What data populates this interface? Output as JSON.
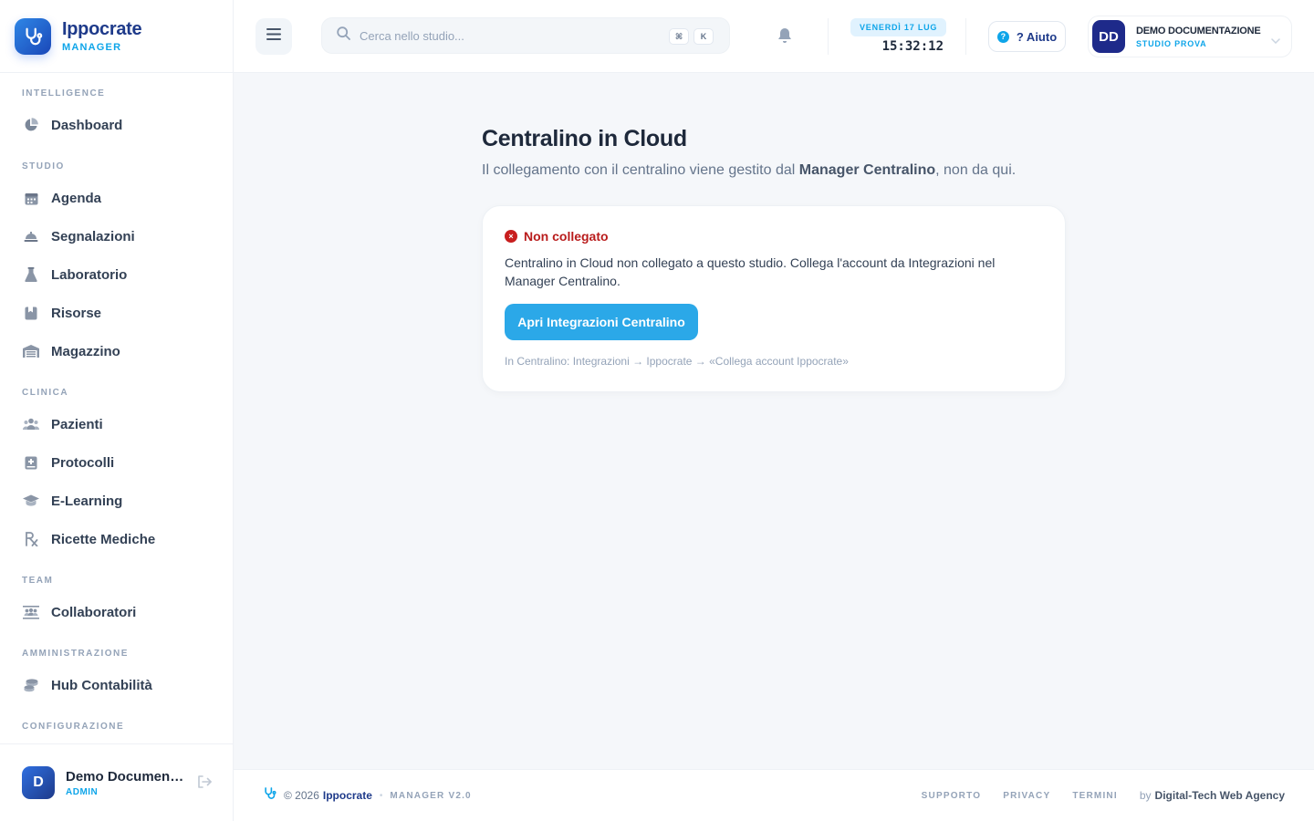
{
  "brand": {
    "name": "Ippocrate",
    "subtitle": "MANAGER"
  },
  "colors": {
    "brand_blue": "#1e3a8a",
    "accent": "#0ea5e9",
    "primary_button": "#2ba8e8",
    "error": "#b91c1c"
  },
  "sidebar": {
    "sections": [
      {
        "label": "INTELLIGENCE",
        "items": [
          {
            "label": "Dashboard",
            "icon": "pie-chart-icon"
          }
        ]
      },
      {
        "label": "STUDIO",
        "items": [
          {
            "label": "Agenda",
            "icon": "calendar-icon"
          },
          {
            "label": "Segnalazioni",
            "icon": "bell-service-icon"
          },
          {
            "label": "Laboratorio",
            "icon": "flask-icon"
          },
          {
            "label": "Risorse",
            "icon": "bookmark-icon"
          },
          {
            "label": "Magazzino",
            "icon": "warehouse-icon"
          }
        ]
      },
      {
        "label": "CLINICA",
        "items": [
          {
            "label": "Pazienti",
            "icon": "users-icon"
          },
          {
            "label": "Protocolli",
            "icon": "medical-book-icon"
          },
          {
            "label": "E-Learning",
            "icon": "graduation-cap-icon"
          },
          {
            "label": "Ricette Mediche",
            "icon": "prescription-icon"
          }
        ]
      },
      {
        "label": "TEAM",
        "items": [
          {
            "label": "Collaboratori",
            "icon": "team-icon"
          }
        ]
      },
      {
        "label": "AMMINISTRAZIONE",
        "items": [
          {
            "label": "Hub Contabilità",
            "icon": "coins-icon"
          }
        ]
      },
      {
        "label": "CONFIGURAZIONE",
        "items": []
      }
    ],
    "user": {
      "initial": "D",
      "name": "Demo Documentazione",
      "role": "ADMIN"
    }
  },
  "header": {
    "search": {
      "placeholder": "Cerca nello studio...",
      "shortcut_mod": "⌘",
      "shortcut_key": "K"
    },
    "date": "VENERDÌ 17 LUG",
    "time": "15:32:12",
    "help": {
      "icon_glyph": "?",
      "label": "? Aiuto"
    },
    "account": {
      "initials": "DD",
      "name": "DEMO DOCUMENTAZIONE",
      "studio": "STUDIO PROVA"
    }
  },
  "main": {
    "title": "Centralino in Cloud",
    "subtitle_pre": "Il collegamento con il centralino viene gestito dal ",
    "subtitle_strong": "Manager Centralino",
    "subtitle_post": ", non da qui.",
    "card": {
      "status": "Non collegato",
      "status_glyph": "×",
      "message": "Centralino in Cloud non collegato a questo studio. Collega l'account da Integrazioni nel Manager Centralino.",
      "button": "Apri Integrazioni Centralino",
      "hint": "In Centralino: Integrazioni → Ippocrate → «Collega account Ippocrate»"
    }
  },
  "footer": {
    "copyright": "© 2026",
    "brand": "Ippocrate",
    "separator": "•",
    "version": "MANAGER V2.0",
    "links": [
      "SUPPORTO",
      "PRIVACY",
      "TERMINI"
    ],
    "by": "by",
    "agency": "Digital-Tech Web Agency"
  }
}
